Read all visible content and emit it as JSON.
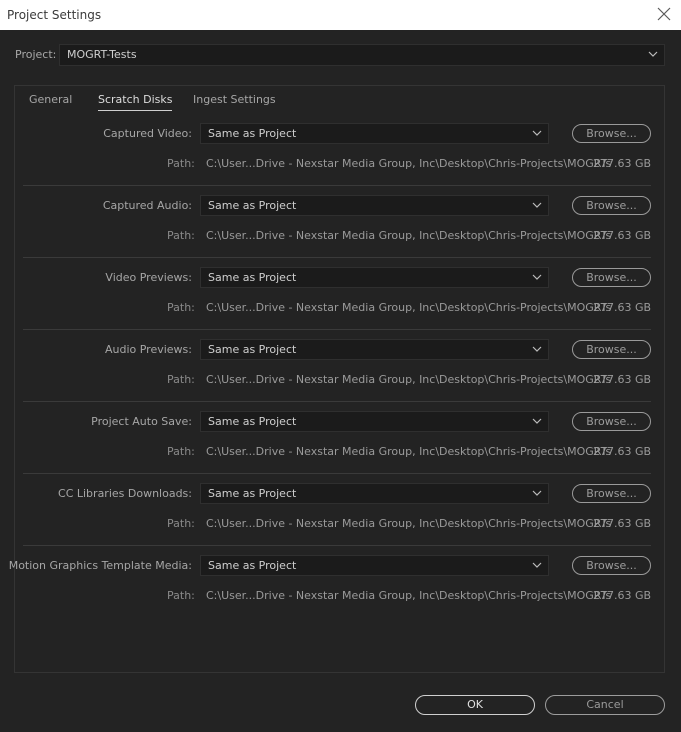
{
  "window": {
    "title": "Project Settings"
  },
  "project": {
    "label": "Project:",
    "value": "MOGRT-Tests"
  },
  "tabs": [
    {
      "label": "General",
      "active": false
    },
    {
      "label": "Scratch Disks",
      "active": true
    },
    {
      "label": "Ingest Settings",
      "active": false
    }
  ],
  "scratch_disks": [
    {
      "label": "Captured Video:",
      "value": "Same as Project",
      "browse": "Browse...",
      "path_label": "Path:",
      "path": "C:\\User...Drive - Nexstar Media Group, Inc\\Desktop\\Chris-Projects\\MOGRTs",
      "size": "277.63 GB"
    },
    {
      "label": "Captured Audio:",
      "value": "Same as Project",
      "browse": "Browse...",
      "path_label": "Path:",
      "path": "C:\\User...Drive - Nexstar Media Group, Inc\\Desktop\\Chris-Projects\\MOGRTs",
      "size": "277.63 GB"
    },
    {
      "label": "Video Previews:",
      "value": "Same as Project",
      "browse": "Browse...",
      "path_label": "Path:",
      "path": "C:\\User...Drive - Nexstar Media Group, Inc\\Desktop\\Chris-Projects\\MOGRTs",
      "size": "277.63 GB"
    },
    {
      "label": "Audio Previews:",
      "value": "Same as Project",
      "browse": "Browse...",
      "path_label": "Path:",
      "path": "C:\\User...Drive - Nexstar Media Group, Inc\\Desktop\\Chris-Projects\\MOGRTs",
      "size": "277.63 GB"
    },
    {
      "label": "Project Auto Save:",
      "value": "Same as Project",
      "browse": "Browse...",
      "path_label": "Path:",
      "path": "C:\\User...Drive - Nexstar Media Group, Inc\\Desktop\\Chris-Projects\\MOGRTs",
      "size": "277.63 GB"
    },
    {
      "label": "CC Libraries Downloads:",
      "value": "Same as Project",
      "browse": "Browse...",
      "path_label": "Path:",
      "path": "C:\\User...Drive - Nexstar Media Group, Inc\\Desktop\\Chris-Projects\\MOGRTs",
      "size": "277.63 GB"
    },
    {
      "label": "Motion Graphics Template Media:",
      "value": "Same as Project",
      "browse": "Browse...",
      "path_label": "Path:",
      "path": "C:\\User...Drive - Nexstar Media Group, Inc\\Desktop\\Chris-Projects\\MOGRTs",
      "size": "277.63 GB"
    }
  ],
  "buttons": {
    "ok": "OK",
    "cancel": "Cancel"
  },
  "icons": {
    "close": "close-icon",
    "dropdown": "chevron-down-icon"
  },
  "colors": {
    "background": "#232323",
    "titlebar": "#ffffff",
    "field": "#1b1b1b"
  }
}
